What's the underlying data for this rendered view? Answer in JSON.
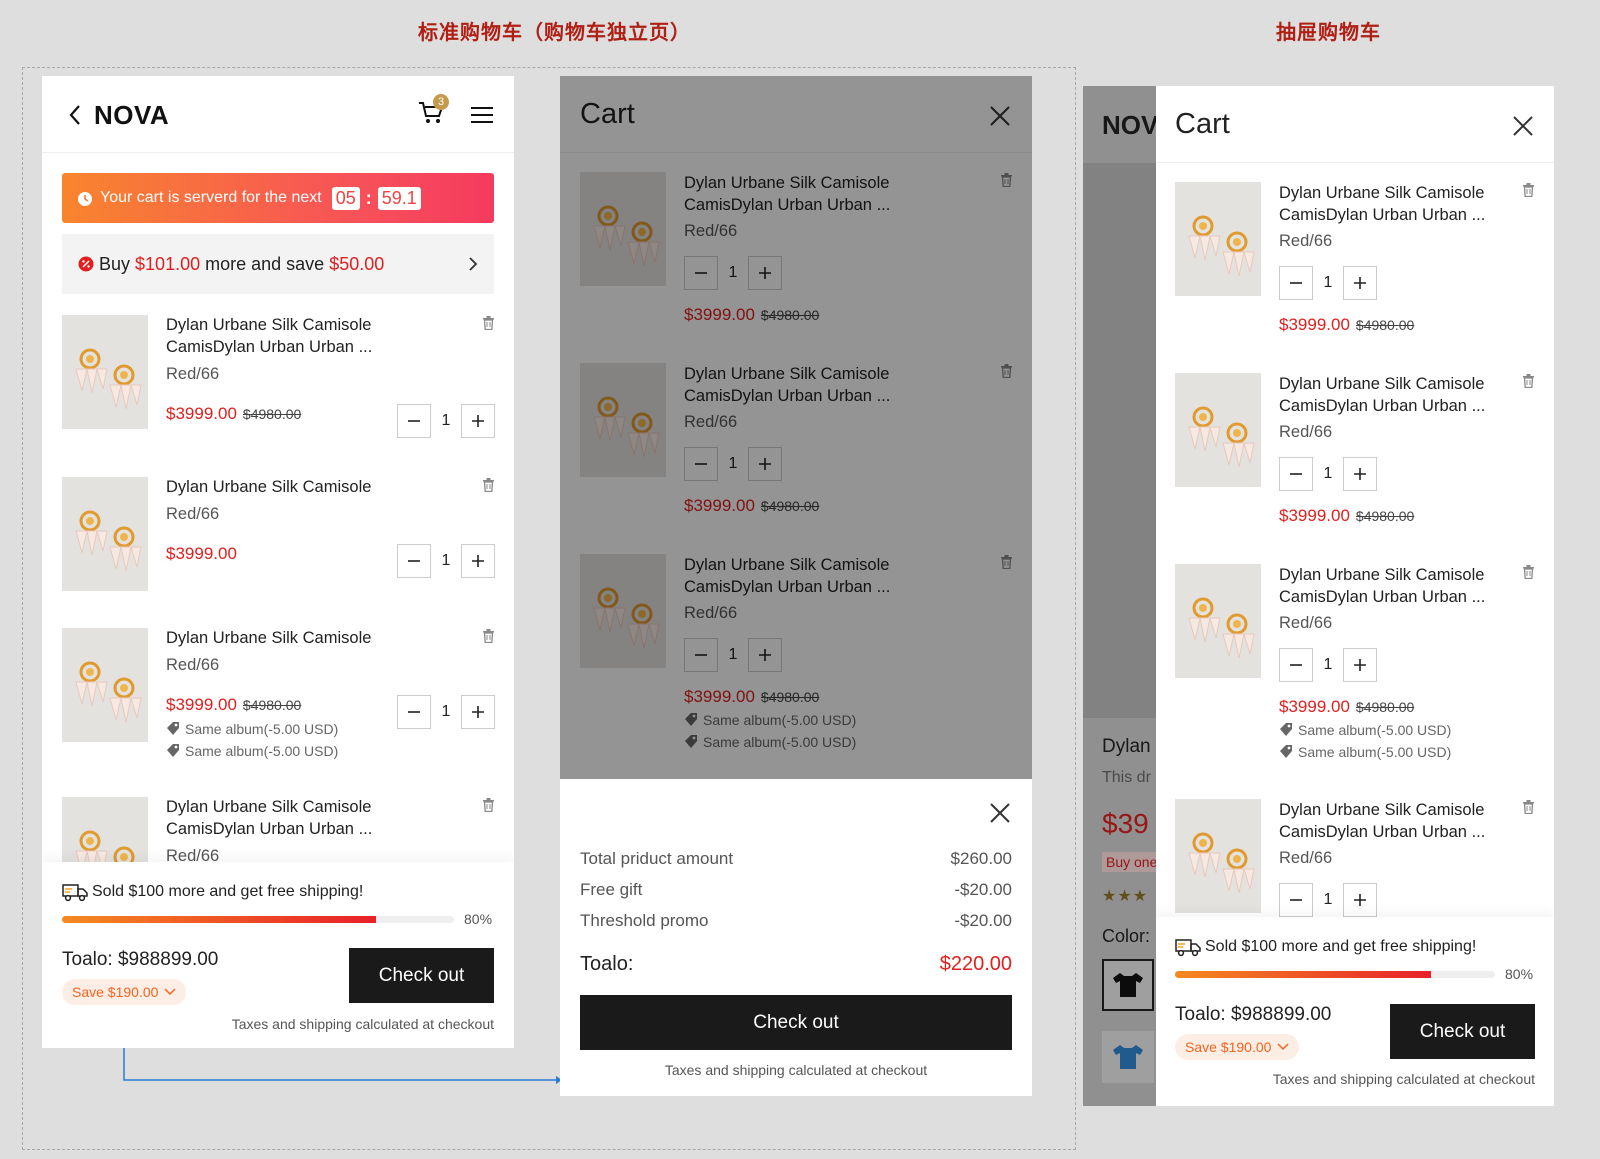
{
  "headings": {
    "standard": "标准购物车（购物车独立页）",
    "drawer": "抽屉购物车"
  },
  "colors": {
    "accent_red": "#e0201f",
    "orange": "#f5631f",
    "dark": "#1a1a1a"
  },
  "page": {
    "brand": "NOVA",
    "cart_badge": "3",
    "timer": {
      "text": "Your cart is serverd for the next",
      "minutes": "05",
      "seconds": "59.1"
    },
    "offer": {
      "prefix": "Buy",
      "amount": "$101.00",
      "middle": "more and save",
      "save": "$50.00"
    },
    "items": [
      {
        "name": "Dylan Urbane Silk Camisole CamisDylan Urban  Urban ...",
        "variant": "Red/66",
        "price": "$3999.00",
        "old_price": "$4980.00",
        "qty": "1"
      },
      {
        "name": "Dylan Urbane Silk Camisole",
        "variant": "Red/66",
        "price": "$3999.00",
        "old_price": "",
        "qty": "1"
      },
      {
        "name": "Dylan Urbane Silk Camisole",
        "variant": "Red/66",
        "price": "$3999.00",
        "old_price": "$4980.00",
        "qty": "1",
        "promos": [
          "Same album(-5.00 USD)",
          "Same album(-5.00 USD)"
        ]
      },
      {
        "name": "Dylan Urbane Silk Camisole CamisDylan Urban  Urban ...",
        "variant": "Red/66"
      }
    ],
    "shipping": {
      "text": "Sold $100 more and get free shipping!",
      "progress": 80,
      "progress_label": "80%"
    },
    "total": "Toalo: $988899.00",
    "save_pill": "Save $190.00",
    "checkout": "Check out",
    "tax_note": "Taxes and shipping calculated at checkout"
  },
  "summary": {
    "title": "Cart",
    "items": [
      {
        "name": "Dylan Urbane Silk Camisole CamisDylan Urban  Urban ...",
        "variant": "Red/66",
        "qty": "1",
        "price": "$3999.00",
        "old_price": "$4980.00"
      },
      {
        "name": "Dylan Urbane Silk Camisole CamisDylan Urban  Urban ...",
        "variant": "Red/66",
        "qty": "1",
        "price": "$3999.00",
        "old_price": "$4980.00"
      },
      {
        "name": "Dylan Urbane Silk Camisole CamisDylan Urban  Urban ...",
        "variant": "Red/66",
        "qty": "1",
        "price": "$3999.00",
        "old_price": "$4980.00",
        "promos": [
          "Same album(-5.00 USD)",
          "Same album(-5.00 USD)"
        ]
      }
    ],
    "rows": [
      {
        "label": "Total priduct amount",
        "value": "$260.00"
      },
      {
        "label": "Free gift",
        "value": "-$20.00"
      },
      {
        "label": "Threshold promo",
        "value": "-$20.00"
      }
    ],
    "total_label": "Toalo:",
    "total_value": "$220.00",
    "checkout": "Check out",
    "tax_note": "Taxes and shipping calculated at checkout"
  },
  "drawer": {
    "bg": {
      "brand": "NOV",
      "title": "Dylan",
      "desc": "This dr",
      "price": "$39",
      "buy": "Buy one",
      "color_label": "Color:"
    },
    "title": "Cart",
    "items": [
      {
        "name": "Dylan Urbane Silk Camisole CamisDylan Urban  Urban ...",
        "variant": "Red/66",
        "qty": "1",
        "price": "$3999.00",
        "old_price": "$4980.00"
      },
      {
        "name": "Dylan Urbane Silk Camisole CamisDylan Urban  Urban ...",
        "variant": "Red/66",
        "qty": "1",
        "price": "$3999.00",
        "old_price": "$4980.00"
      },
      {
        "name": "Dylan Urbane Silk Camisole CamisDylan Urban  Urban ...",
        "variant": "Red/66",
        "qty": "1",
        "price": "$3999.00",
        "old_price": "$4980.00",
        "promos": [
          "Same album(-5.00 USD)",
          "Same album(-5.00 USD)"
        ]
      },
      {
        "name": "Dylan Urbane Silk Camisole CamisDylan Urban  Urban ...",
        "variant": "Red/66",
        "qty": "1"
      }
    ],
    "shipping": {
      "text": "Sold $100 more and get free shipping!",
      "progress": 80,
      "progress_label": "80%"
    },
    "total": "Toalo: $988899.00",
    "save_pill": "Save $190.00",
    "checkout": "Check out",
    "tax_note": "Taxes and shipping calculated at checkout"
  }
}
